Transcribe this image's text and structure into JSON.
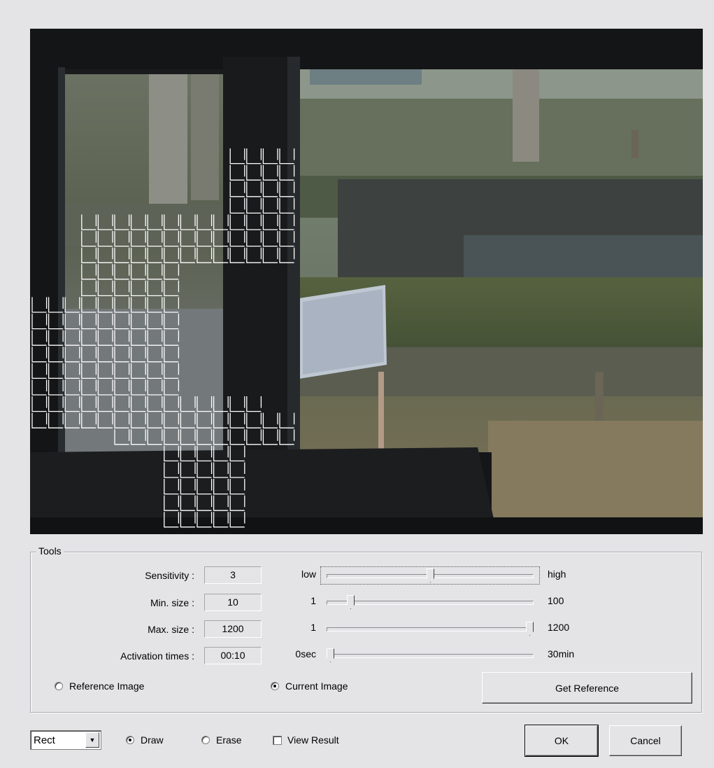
{
  "tools": {
    "group_label": "Tools",
    "sensitivity": {
      "label": "Sensitivity :",
      "value": "3",
      "min_label": "low",
      "max_label": "high",
      "level": 0.5
    },
    "min_size": {
      "label": "Min. size :",
      "value": "10",
      "min_label": "1",
      "max_label": "100",
      "level": 0.1
    },
    "max_size": {
      "label": "Max. size :",
      "value": "1200",
      "min_label": "1",
      "max_label": "1200",
      "level": 1.0
    },
    "activation_times": {
      "label": "Activation times :",
      "value": "00:10",
      "min_label": "0sec",
      "max_label": "30min",
      "level": 0.0
    },
    "image_mode": {
      "reference_label": "Reference Image",
      "current_label": "Current Image",
      "selected": "current"
    },
    "get_reference_label": "Get Reference"
  },
  "footer": {
    "shape_value": "Rect",
    "draw_label": "Draw",
    "erase_label": "Erase",
    "mode_selected": "draw",
    "view_result_label": "View Result",
    "view_result_checked": false,
    "ok_label": "OK",
    "cancel_label": "Cancel"
  },
  "colors": {
    "dialog_bg": "#e4e3e6",
    "grid_line": "#ffffff"
  },
  "icons": {
    "dropdown": "triangle-down"
  }
}
